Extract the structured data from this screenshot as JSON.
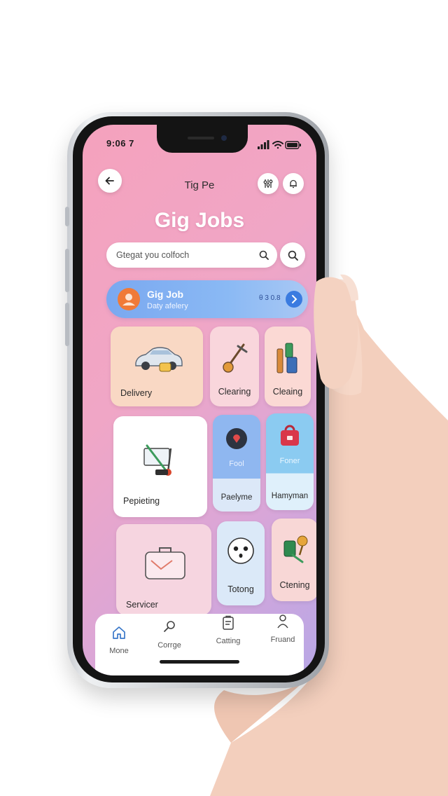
{
  "status": {
    "time": "9:06 7"
  },
  "header": {
    "title": "Tig Pe",
    "page_title": "Gig Jobs"
  },
  "search": {
    "placeholder": "Gtegat you colfoch"
  },
  "banner": {
    "title": "Gig Job",
    "subtitle": "Daty afelery",
    "count": "θ 3 0.8"
  },
  "categories": [
    {
      "label": "Delivery",
      "icon": "car-icon",
      "bg": "#f9d8c4"
    },
    {
      "label": "Clearing",
      "icon": "mop-icon",
      "bg": "#f9d6dc"
    },
    {
      "label": "Cleaing",
      "icon": "cleaning-tools-icon",
      "bg": "#fbd9d4"
    },
    {
      "label": "Pepieting",
      "icon": "painting-tools-icon",
      "bg": "#ffffff"
    },
    {
      "label": "Paelyme",
      "icon": "pin-icon",
      "bg": "#a9c9f3",
      "sublabel": "Fool"
    },
    {
      "label": "Hamyman",
      "icon": "toolbox-icon",
      "bg": "#9ed3f3",
      "sublabel": "Foner"
    },
    {
      "label": "Servicer",
      "icon": "briefcase-icon",
      "bg": "#f6d5e0"
    },
    {
      "label": "Totong",
      "icon": "face-icon",
      "bg": "#dbe9f8"
    },
    {
      "label": "Ctening",
      "icon": "spray-icon",
      "bg": "#f8d7d6"
    }
  ],
  "nav": [
    {
      "label": "Mone",
      "icon": "home-icon"
    },
    {
      "label": "Corrge",
      "icon": "search-icon"
    },
    {
      "label": "Catting",
      "icon": "clipboard-icon"
    },
    {
      "label": "Fruand",
      "icon": "profile-icon"
    }
  ],
  "colors": {
    "screen_gradient_start": "#f5a2bd",
    "screen_gradient_end": "#b8a7e6",
    "banner": "#7aa8f0",
    "accent": "#3a7be0"
  }
}
